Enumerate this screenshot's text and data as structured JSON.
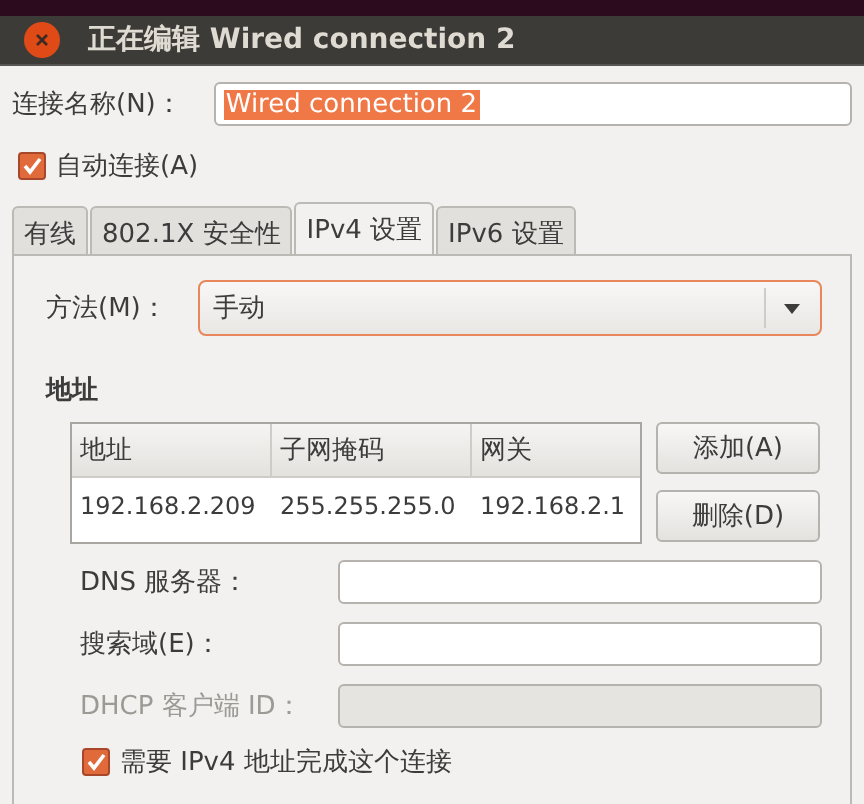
{
  "window": {
    "title": "正在编辑 Wired connection 2"
  },
  "connection_name": {
    "label": "连接名称(N)：",
    "value": "Wired connection 2",
    "highlighted": true
  },
  "auto_connect": {
    "label": "自动连接(A)",
    "checked": true
  },
  "tabs": [
    {
      "label": "有线",
      "selected": false
    },
    {
      "label": "802.1X 安全性",
      "selected": false
    },
    {
      "label": "IPv4 设置",
      "selected": true
    },
    {
      "label": "IPv6 设置",
      "selected": false
    }
  ],
  "method": {
    "label": "方法(M)：",
    "value": "手动"
  },
  "addresses": {
    "title": "地址",
    "columns": [
      "地址",
      "子网掩码",
      "网关"
    ],
    "rows": [
      [
        "192.168.2.209",
        "255.255.255.0",
        "192.168.2.1"
      ]
    ]
  },
  "buttons": [
    {
      "label": "添加(A)"
    },
    {
      "label": "删除(D)"
    }
  ],
  "fields": [
    {
      "label": "DNS 服务器：",
      "disabled": false
    },
    {
      "label": "搜索域(E)：",
      "disabled": false
    },
    {
      "label": "DHCP 客户端 ID：",
      "disabled": true
    }
  ],
  "require_ipv4": {
    "label": "需要 IPv4 地址完成这个连接",
    "checked": true
  }
}
